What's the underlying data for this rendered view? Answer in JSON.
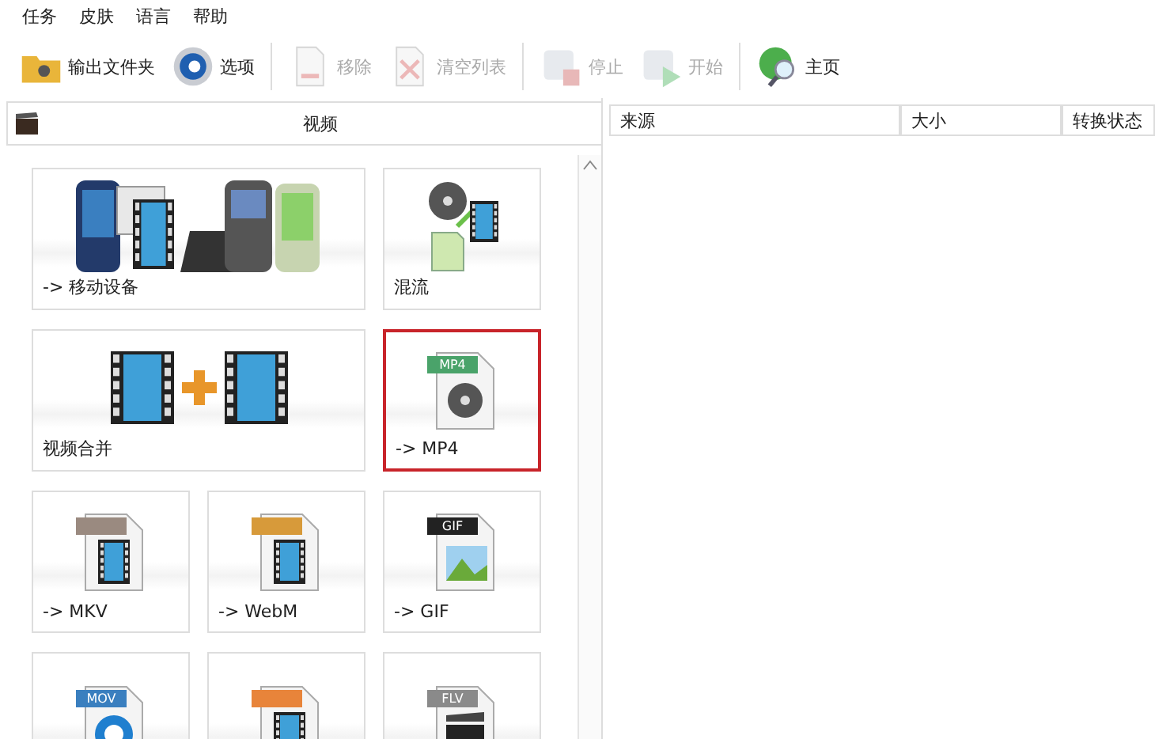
{
  "menu": [
    "任务",
    "皮肤",
    "语言",
    "帮助"
  ],
  "toolbar": [
    {
      "label": "输出文件夹",
      "disabled": false
    },
    {
      "label": "选项",
      "disabled": false
    },
    {
      "label": "移除",
      "disabled": true
    },
    {
      "label": "清空列表",
      "disabled": true
    },
    {
      "label": "停止",
      "disabled": true
    },
    {
      "label": "开始",
      "disabled": true
    },
    {
      "label": "主页",
      "disabled": false
    }
  ],
  "panel": {
    "title": "视频"
  },
  "tiles": [
    {
      "kind": "devices",
      "label": "-> 移动设备",
      "wide": true,
      "selected": false
    },
    {
      "kind": "mux",
      "label": "混流",
      "wide": false,
      "selected": false
    },
    {
      "kind": "merge",
      "label": "视频合并",
      "wide": true,
      "selected": false
    },
    {
      "kind": "reel",
      "badge": "MP4",
      "color": "#4aa36a",
      "label": "-> MP4",
      "wide": false,
      "selected": true
    },
    {
      "kind": "film",
      "color": "#9a8a80",
      "label": "-> MKV",
      "wide": false,
      "selected": false
    },
    {
      "kind": "film",
      "color": "#d79a3a",
      "label": "-> WebM",
      "wide": false,
      "selected": false
    },
    {
      "kind": "image",
      "badge": "GIF",
      "color": "#222222",
      "label": "-> GIF",
      "wide": false,
      "selected": false
    },
    {
      "kind": "quicktime",
      "badge": "MOV",
      "color": "#3a7fbf",
      "wide": false,
      "selected": false
    },
    {
      "kind": "film",
      "color": "#e8843a",
      "wide": false,
      "selected": false
    },
    {
      "kind": "clapper",
      "badge": "FLV",
      "color": "#8a8a8a",
      "wide": false,
      "selected": false
    }
  ],
  "table": {
    "columns": [
      "来源",
      "大小",
      "转换状态"
    ]
  }
}
